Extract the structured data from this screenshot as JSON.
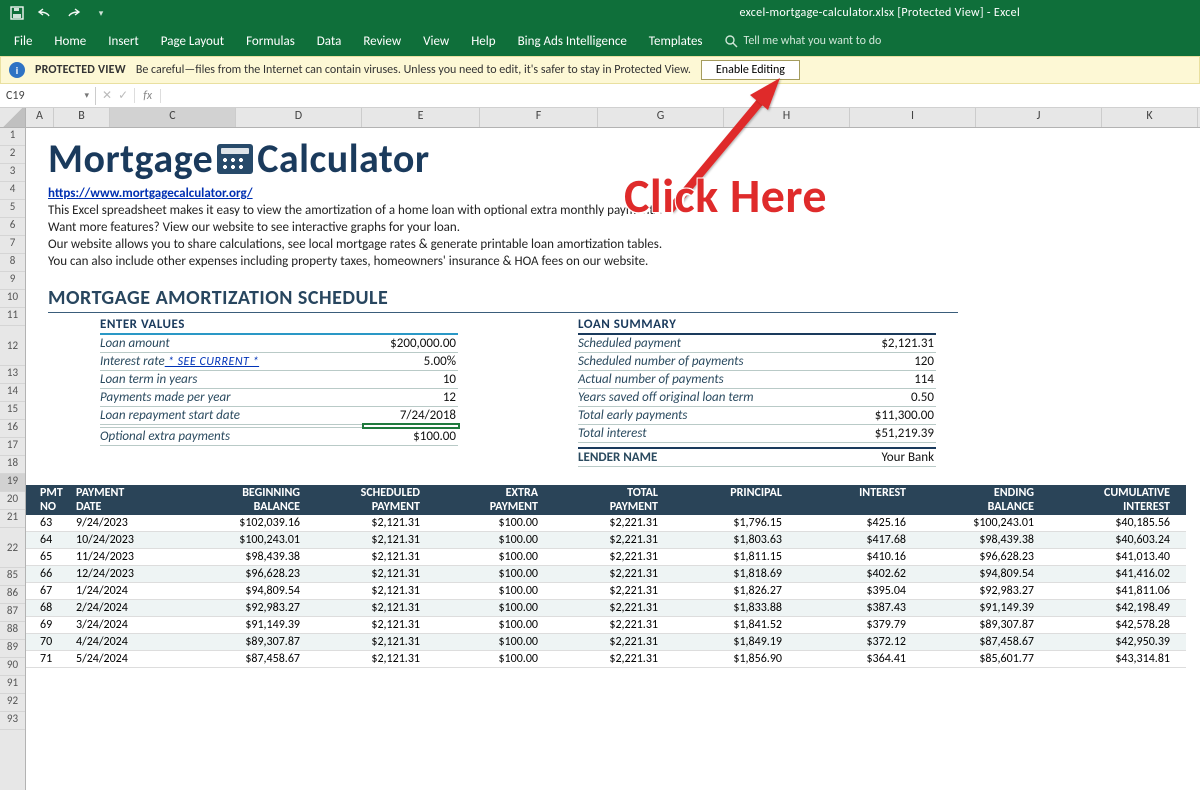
{
  "window": {
    "title": "excel-mortgage-calculator.xlsx  [Protected View]  -  Excel"
  },
  "ribbon": {
    "tabs": [
      "File",
      "Home",
      "Insert",
      "Page Layout",
      "Formulas",
      "Data",
      "Review",
      "View",
      "Help",
      "Bing Ads Intelligence",
      "Templates"
    ],
    "search_placeholder": "Tell me what you want to do"
  },
  "protected": {
    "title": "PROTECTED VIEW",
    "msg": "Be careful—files from the Internet can contain viruses. Unless you need to edit, it's safer to stay in Protected View.",
    "button": "Enable Editing"
  },
  "namebox": "C19",
  "row_headers_top": [
    "1",
    "2",
    "3",
    "4",
    "5",
    "6",
    "7",
    "8",
    "9",
    "10",
    "11",
    "12",
    "13",
    "14",
    "15",
    "16",
    "17",
    "18",
    "19",
    "20",
    "21",
    "22"
  ],
  "row_headers_bottom": [
    "85",
    "86",
    "87",
    "88",
    "89",
    "90",
    "91",
    "92",
    "93"
  ],
  "columns": [
    "A",
    "B",
    "C",
    "D",
    "E",
    "F",
    "G",
    "H",
    "I",
    "J",
    "K"
  ],
  "logo": {
    "part1": "Mortgage",
    "part2": "Calculator"
  },
  "intro": {
    "url": "https://www.mortgagecalculator.org/",
    "l1": "This Excel spreadsheet makes it easy to view the amortization of a home loan with optional extra monthly payments.",
    "l2": "Want more features? View our website to see interactive graphs for your loan.",
    "l3": "Our website allows you to share calculations, see local mortgage rates & generate printable loan amortization tables.",
    "l4": "You can also include other expenses including property taxes, homeowners' insurance & HOA fees on our website."
  },
  "section_title": "MORTGAGE AMORTIZATION SCHEDULE",
  "enter_values": {
    "header": "ENTER VALUES",
    "rows": [
      {
        "k": "Loan amount",
        "v": "$200,000.00"
      },
      {
        "k": "Interest rate",
        "link": "* SEE CURRENT *",
        "v": "5.00%"
      },
      {
        "k": "Loan term in years",
        "v": "10"
      },
      {
        "k": "Payments made per year",
        "v": "12"
      },
      {
        "k": "Loan repayment start date",
        "v": "7/24/2018"
      }
    ],
    "optional_k": "Optional extra payments",
    "optional_v": "$100.00"
  },
  "loan_summary": {
    "header": "LOAN SUMMARY",
    "rows": [
      {
        "k": "Scheduled payment",
        "v": "$2,121.31"
      },
      {
        "k": "Scheduled number of payments",
        "v": "120"
      },
      {
        "k": "Actual number of payments",
        "v": "114"
      },
      {
        "k": "Years saved off original loan term",
        "v": "0.50"
      },
      {
        "k": "Total early payments",
        "v": "$11,300.00"
      },
      {
        "k": "Total interest",
        "v": "$51,219.39"
      }
    ],
    "lender_k": "LENDER NAME",
    "lender_v": "Your Bank"
  },
  "schedule": {
    "headers": [
      "PMT NO",
      "PAYMENT DATE",
      "BEGINNING BALANCE",
      "SCHEDULED PAYMENT",
      "EXTRA PAYMENT",
      "TOTAL PAYMENT",
      "PRINCIPAL",
      "INTEREST",
      "ENDING BALANCE",
      "CUMULATIVE INTEREST"
    ],
    "rows": [
      [
        "63",
        "9/24/2023",
        "$102,039.16",
        "$2,121.31",
        "$100.00",
        "$2,221.31",
        "$1,796.15",
        "$425.16",
        "$100,243.01",
        "$40,185.56"
      ],
      [
        "64",
        "10/24/2023",
        "$100,243.01",
        "$2,121.31",
        "$100.00",
        "$2,221.31",
        "$1,803.63",
        "$417.68",
        "$98,439.38",
        "$40,603.24"
      ],
      [
        "65",
        "11/24/2023",
        "$98,439.38",
        "$2,121.31",
        "$100.00",
        "$2,221.31",
        "$1,811.15",
        "$410.16",
        "$96,628.23",
        "$41,013.40"
      ],
      [
        "66",
        "12/24/2023",
        "$96,628.23",
        "$2,121.31",
        "$100.00",
        "$2,221.31",
        "$1,818.69",
        "$402.62",
        "$94,809.54",
        "$41,416.02"
      ],
      [
        "67",
        "1/24/2024",
        "$94,809.54",
        "$2,121.31",
        "$100.00",
        "$2,221.31",
        "$1,826.27",
        "$395.04",
        "$92,983.27",
        "$41,811.06"
      ],
      [
        "68",
        "2/24/2024",
        "$92,983.27",
        "$2,121.31",
        "$100.00",
        "$2,221.31",
        "$1,833.88",
        "$387.43",
        "$91,149.39",
        "$42,198.49"
      ],
      [
        "69",
        "3/24/2024",
        "$91,149.39",
        "$2,121.31",
        "$100.00",
        "$2,221.31",
        "$1,841.52",
        "$379.79",
        "$89,307.87",
        "$42,578.28"
      ],
      [
        "70",
        "4/24/2024",
        "$89,307.87",
        "$2,121.31",
        "$100.00",
        "$2,221.31",
        "$1,849.19",
        "$372.12",
        "$87,458.67",
        "$42,950.39"
      ],
      [
        "71",
        "5/24/2024",
        "$87,458.67",
        "$2,121.31",
        "$100.00",
        "$2,221.31",
        "$1,856.90",
        "$364.41",
        "$85,601.77",
        "$43,314.81"
      ]
    ]
  },
  "annotation": "Click Here",
  "chart_data": {
    "type": "table",
    "title": "Mortgage Amortization Schedule",
    "columns": [
      "PMT NO",
      "PAYMENT DATE",
      "BEGINNING BALANCE",
      "SCHEDULED PAYMENT",
      "EXTRA PAYMENT",
      "TOTAL PAYMENT",
      "PRINCIPAL",
      "INTEREST",
      "ENDING BALANCE",
      "CUMULATIVE INTEREST"
    ],
    "rows": [
      [
        63,
        "9/24/2023",
        102039.16,
        2121.31,
        100.0,
        2221.31,
        1796.15,
        425.16,
        100243.01,
        40185.56
      ],
      [
        64,
        "10/24/2023",
        100243.01,
        2121.31,
        100.0,
        2221.31,
        1803.63,
        417.68,
        98439.38,
        40603.24
      ],
      [
        65,
        "11/24/2023",
        98439.38,
        2121.31,
        100.0,
        2221.31,
        1811.15,
        410.16,
        96628.23,
        41013.4
      ],
      [
        66,
        "12/24/2023",
        96628.23,
        2121.31,
        100.0,
        2221.31,
        1818.69,
        402.62,
        94809.54,
        41416.02
      ],
      [
        67,
        "1/24/2024",
        94809.54,
        2121.31,
        100.0,
        2221.31,
        1826.27,
        395.04,
        92983.27,
        41811.06
      ],
      [
        68,
        "2/24/2024",
        92983.27,
        2121.31,
        100.0,
        2221.31,
        1833.88,
        387.43,
        91149.39,
        42198.49
      ],
      [
        69,
        "3/24/2024",
        91149.39,
        2121.31,
        100.0,
        2221.31,
        1841.52,
        379.79,
        89307.87,
        42578.28
      ],
      [
        70,
        "4/24/2024",
        89307.87,
        2121.31,
        100.0,
        2221.31,
        1849.19,
        372.12,
        87458.67,
        42950.39
      ],
      [
        71,
        "5/24/2024",
        87458.67,
        2121.31,
        100.0,
        2221.31,
        1856.9,
        364.41,
        85601.77,
        43314.81
      ]
    ]
  }
}
